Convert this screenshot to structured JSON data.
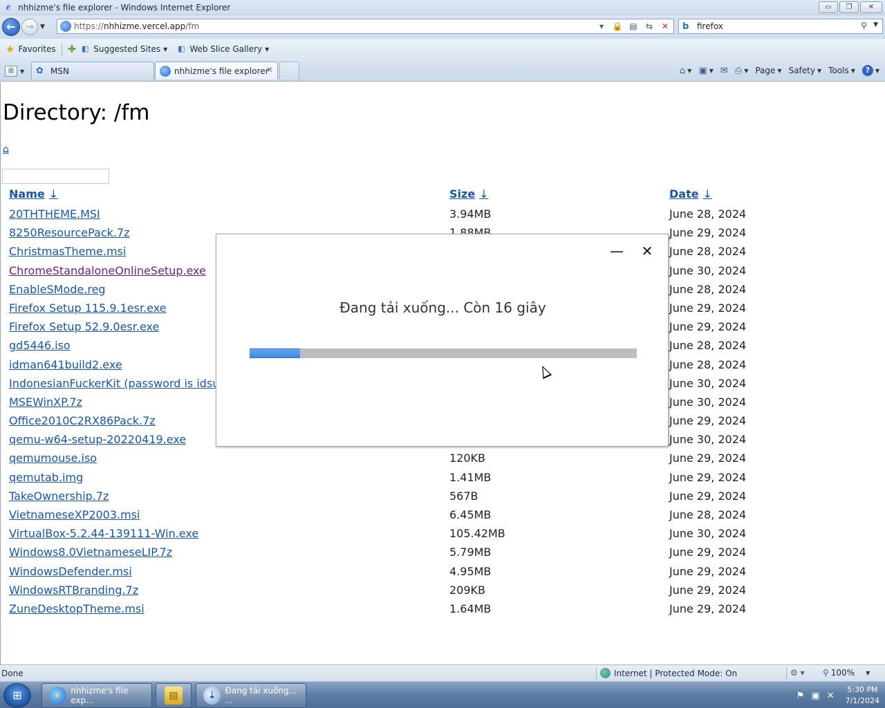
{
  "window": {
    "title": "nhhizme's file explorer - Windows Internet Explorer",
    "minimize_glyph": "▭",
    "restore_glyph": "❐",
    "close_glyph": "✕"
  },
  "address": {
    "url_prefix": "https://",
    "url_host": "nhhizme.vercel.app",
    "url_path": "/fm",
    "search_value": "firefox"
  },
  "favorites": {
    "favorites_label": "Favorites",
    "items": [
      {
        "label": "Suggested Sites"
      },
      {
        "label": "Web Slice Gallery"
      }
    ]
  },
  "tabs": [
    {
      "label": "MSN",
      "active": false
    },
    {
      "label": "nhhizme's file explorer",
      "active": true
    }
  ],
  "commandbar": {
    "page_label": "Page",
    "safety_label": "Safety",
    "tools_label": "Tools",
    "help_glyph": "?"
  },
  "page": {
    "title": "Directory: /fm",
    "home_link_glyph": "⌂",
    "filter_value": "",
    "columns": {
      "name": "Name",
      "size": "Size",
      "date": "Date",
      "sort_glyph": "↓"
    },
    "files": [
      {
        "name": "20THTHEME.MSI",
        "size": "3.94MB",
        "date": "June 28, 2024",
        "visited": false
      },
      {
        "name": "8250ResourcePack.7z",
        "size": "1.88MB",
        "date": "June 29, 2024",
        "visited": false
      },
      {
        "name": "ChristmasTheme.msi",
        "size": "",
        "date": "June 28, 2024",
        "visited": false
      },
      {
        "name": "ChromeStandaloneOnlineSetup.exe",
        "size": "",
        "date": "June 30, 2024",
        "visited": true
      },
      {
        "name": "EnableSMode.reg",
        "size": "",
        "date": "June 28, 2024",
        "visited": false
      },
      {
        "name": "Firefox Setup 115.9.1esr.exe",
        "size": "",
        "date": "June 29, 2024",
        "visited": false
      },
      {
        "name": "Firefox Setup 52.9.0esr.exe",
        "size": "",
        "date": "June 29, 2024",
        "visited": false
      },
      {
        "name": "gd5446.iso",
        "size": "",
        "date": "June 28, 2024",
        "visited": false
      },
      {
        "name": "idman641build2.exe",
        "size": "",
        "date": "June 28, 2024",
        "visited": false
      },
      {
        "name": "IndonesianFuckerKit (password is idsuc",
        "size": "",
        "date": "June 30, 2024",
        "visited": false
      },
      {
        "name": "MSEWinXP.7z",
        "size": "",
        "date": "June 30, 2024",
        "visited": false
      },
      {
        "name": "Office2010C2RX86Pack.7z",
        "size": "",
        "date": "June 29, 2024",
        "visited": false
      },
      {
        "name": "qemu-w64-setup-20220419.exe",
        "size": "",
        "date": "June 30, 2024",
        "visited": false
      },
      {
        "name": "qemumouse.iso",
        "size": "120KB",
        "date": "June 29, 2024",
        "visited": false
      },
      {
        "name": "qemutab.img",
        "size": "1.41MB",
        "date": "June 29, 2024",
        "visited": false
      },
      {
        "name": "TakeOwnership.7z",
        "size": "567B",
        "date": "June 29, 2024",
        "visited": false
      },
      {
        "name": "VietnameseXP2003.msi",
        "size": "6.45MB",
        "date": "June 28, 2024",
        "visited": false
      },
      {
        "name": "VirtualBox-5.2.44-139111-Win.exe",
        "size": "105.42MB",
        "date": "June 30, 2024",
        "visited": false
      },
      {
        "name": "Windows8.0VietnameseLIP.7z",
        "size": "5.79MB",
        "date": "June 29, 2024",
        "visited": false
      },
      {
        "name": "WindowsDefender.msi",
        "size": "4.95MB",
        "date": "June 29, 2024",
        "visited": false
      },
      {
        "name": "WindowsRTBranding.7z",
        "size": "209KB",
        "date": "June 29, 2024",
        "visited": false
      },
      {
        "name": "ZuneDesktopTheme.msi",
        "size": "1.64MB",
        "date": "June 29, 2024",
        "visited": false
      }
    ]
  },
  "download_dialog": {
    "message": "Đang tải xuống... Còn 16 giây",
    "minimize_glyph": "—",
    "close_glyph": "✕",
    "progress_fraction": 0.13,
    "progress_color": "#4a8fe6"
  },
  "status": {
    "text": "Done",
    "zone": "Internet | Protected Mode: On",
    "zoom": "100%"
  },
  "taskbar": {
    "start_glyph": "⊞",
    "ie_label": "nhhizme's file exp...",
    "download_label": "Đang tải xuống... ...",
    "time": "5:30 PM",
    "date": "7/1/2024"
  }
}
